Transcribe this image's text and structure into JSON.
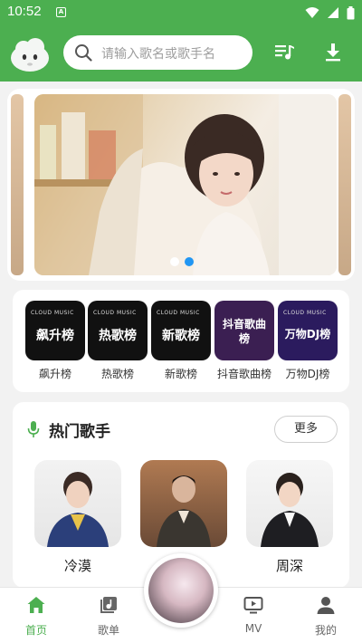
{
  "status_bar": {
    "time": "10:52",
    "notification_glyph": "A"
  },
  "header": {
    "search_placeholder": "请输入歌名或歌手名",
    "icons": [
      "app-logo-icon",
      "search-icon",
      "playlist-icon",
      "download-icon"
    ]
  },
  "banner": {
    "slide_count": 2,
    "active_slide": 2
  },
  "charts": [
    {
      "tile_text": "飙升榜",
      "label": "飙升榜",
      "tile_color": "#111111"
    },
    {
      "tile_text": "热歌榜",
      "label": "热歌榜",
      "tile_color": "#111111"
    },
    {
      "tile_text": "新歌榜",
      "label": "新歌榜",
      "tile_color": "#111111"
    },
    {
      "tile_text": "抖音歌曲榜",
      "label": "抖音歌曲榜",
      "tile_color": "#3b1f52"
    },
    {
      "tile_text": "万物DJ榜",
      "label": "万物DJ榜",
      "tile_color": "#2b1b5e"
    }
  ],
  "chart_brand": "CLOUD MUSIC",
  "hot_singers": {
    "title": "热门歌手",
    "more_label": "更多",
    "singers": [
      {
        "name": "冷漠"
      },
      {
        "name": ""
      },
      {
        "name": "周深"
      }
    ]
  },
  "tabs": [
    {
      "label": "首页",
      "icon": "home-icon",
      "active": true
    },
    {
      "label": "歌单",
      "icon": "songlist-icon",
      "active": false
    },
    {
      "label": "MV",
      "icon": "mv-icon",
      "active": false
    },
    {
      "label": "我的",
      "icon": "profile-icon",
      "active": false
    }
  ],
  "colors": {
    "accent": "#4caf50",
    "banner_dot_active": "#2196f3",
    "banner_dot_inactive": "#ffffff"
  }
}
